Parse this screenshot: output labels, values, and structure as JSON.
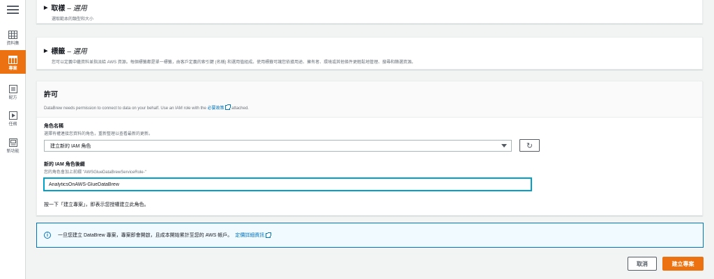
{
  "nav": {
    "items": [
      {
        "label": "資料集",
        "icon": "table-icon",
        "active": false
      },
      {
        "label": "專案",
        "icon": "project-icon",
        "active": true
      },
      {
        "label": "配方",
        "icon": "recipe-icon",
        "active": false
      },
      {
        "label": "任務",
        "icon": "job-icon",
        "active": false
      },
      {
        "label": "新功能",
        "icon": "whats-new-icon",
        "active": false
      }
    ]
  },
  "sampling": {
    "title": "取樣",
    "optional": "– 選用",
    "description": "選取範本的類型和大小"
  },
  "tags": {
    "title": "標籤",
    "optional": "– 選用",
    "description": "您可以定義中繼資料並指派給 AWS 資源。每個標籤都是單一標籤，由客戶定義的索引鍵 (名稱) 和選用值組成。使用標籤可讓您依據用途、擁有者、環境或其他條件更輕鬆地管理、搜尋和篩選資源。"
  },
  "permissions": {
    "title": "許可",
    "desc_before": "DataBrew needs permission to connect to data on your behalf. Use an IAM role with the",
    "desc_link": "必要政策",
    "desc_after": "attached.",
    "role_name_label": "角色名稱",
    "role_name_hint": "選擇有權連接您資料的角色，重新整理以查看最新的更新。",
    "role_select_value": "建立新的 IAM 角色",
    "suffix_label": "新的 IAM 角色後綴",
    "suffix_hint": "您的角色會加上前綴 \"AWSGlueDataBrewServiceRole-\"",
    "suffix_value": "AnalyticsOnAWS-GlueDataBrew",
    "note": "按一下「建立專案」，即表示您授權建立此角色。"
  },
  "info": {
    "text": "一旦您建立 DataBrew 專案，專案即會開啟，且成本開始累計至您的 AWS 帳戶。",
    "link": "定價詳細資訊"
  },
  "actions": {
    "cancel": "取消",
    "create": "建立專案"
  },
  "colors": {
    "accent": "#ec7211",
    "link": "#0073bb",
    "info_bg": "#f1faff"
  }
}
